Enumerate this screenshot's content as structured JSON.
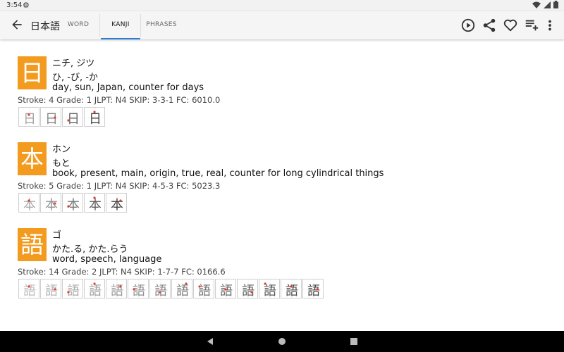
{
  "status_bar": {
    "time": "3:54",
    "icons": [
      "gear-icon",
      "wifi-icon",
      "signal-icon",
      "battery-icon"
    ]
  },
  "app_bar": {
    "title": "日本語",
    "tabs": [
      {
        "label": "WORD",
        "active": false
      },
      {
        "label": "KANJI",
        "active": true
      },
      {
        "label": "PHRASES",
        "active": false
      }
    ],
    "actions": [
      "play-icon",
      "share-icon",
      "favorite-icon",
      "playlist-add-icon",
      "more-vert-icon"
    ],
    "accent_color": "#2b7fd3"
  },
  "kanji_box_color": "#f39b1f",
  "kanji": [
    {
      "character": "日",
      "on": "ニチ, ジツ",
      "kun": "ひ, -び, -か",
      "meaning": "day, sun, Japan, counter for days",
      "stats": "Stroke: 4 Grade: 1  JLPT: N4  SKIP: 3-3-1  FC: 6010.0",
      "stroke_count": 4
    },
    {
      "character": "本",
      "on": "ホン",
      "kun": "もと",
      "meaning": "book, present, main, origin, true, real, counter for long cylindrical things",
      "stats": "Stroke: 5 Grade: 1  JLPT: N4  SKIP: 4-5-3  FC: 5023.3",
      "stroke_count": 5
    },
    {
      "character": "語",
      "on": "ゴ",
      "kun": "かた.る, かた.らう",
      "meaning": "word, speech, language",
      "stats": "Stroke: 14 Grade: 2  JLPT: N4  SKIP: 1-7-7  FC: 0166.6",
      "stroke_count": 14
    }
  ],
  "nav_bar": {
    "buttons": [
      "back-nav-icon",
      "home-nav-icon",
      "recents-nav-icon"
    ]
  }
}
